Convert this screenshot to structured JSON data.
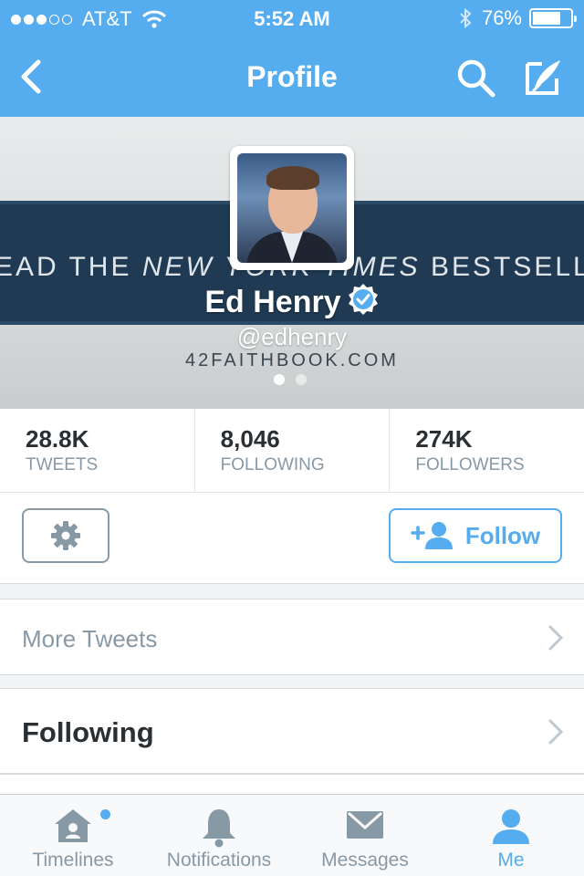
{
  "status_bar": {
    "carrier": "AT&T",
    "time": "5:52 AM",
    "battery": "76%",
    "battery_level": 0.76,
    "signal_bars": 3
  },
  "nav": {
    "title": "Profile",
    "back_icon": "chevron-left-icon",
    "search_icon": "search-icon",
    "compose_icon": "compose-icon"
  },
  "profile": {
    "banner_text_pre": "EAD THE",
    "banner_text_italic": "NEW YORK TIMES",
    "banner_text_post": "BESTSELLER!",
    "name": "Ed Henry",
    "handle": "@edhenry",
    "website": "42FAITHBOOK.COM",
    "verified": true
  },
  "stats": [
    {
      "value": "28.8K",
      "label": "TWEETS"
    },
    {
      "value": "8,046",
      "label": "FOLLOWING"
    },
    {
      "value": "274K",
      "label": "FOLLOWERS"
    }
  ],
  "actions": {
    "follow_label": "Follow"
  },
  "rows": {
    "more_tweets": "More Tweets",
    "following": "Following"
  },
  "tabbar": [
    {
      "label": "Timelines",
      "icon": "home-icon",
      "active": false
    },
    {
      "label": "Notifications",
      "icon": "bell-icon",
      "active": false
    },
    {
      "label": "Messages",
      "icon": "envelope-icon",
      "active": false
    },
    {
      "label": "Me",
      "icon": "person-icon",
      "active": true
    }
  ],
  "colors": {
    "accent": "#55acee",
    "muted": "#8899a6",
    "text": "#292f33"
  }
}
